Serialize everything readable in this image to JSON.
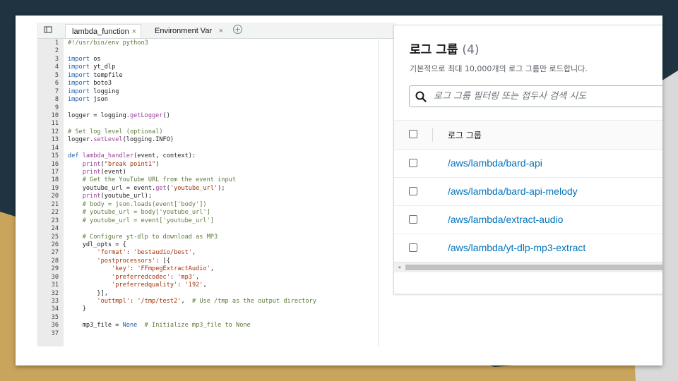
{
  "editor": {
    "tabs": [
      {
        "label": "lambda_function",
        "close": "×"
      },
      {
        "label": "Environment Var",
        "close": "×"
      }
    ],
    "add_tab": "+",
    "lines": [
      {
        "n": "1",
        "tokens": [
          {
            "t": "#!/usr/bin/env python3",
            "c": "cm"
          }
        ]
      },
      {
        "n": "2",
        "tokens": []
      },
      {
        "n": "3",
        "tokens": [
          {
            "t": "import",
            "c": "kw"
          },
          {
            "t": " os",
            "c": ""
          }
        ]
      },
      {
        "n": "4",
        "tokens": [
          {
            "t": "import",
            "c": "kw"
          },
          {
            "t": " yt_dlp",
            "c": ""
          }
        ]
      },
      {
        "n": "5",
        "tokens": [
          {
            "t": "import",
            "c": "kw"
          },
          {
            "t": " tempfile",
            "c": ""
          }
        ]
      },
      {
        "n": "6",
        "tokens": [
          {
            "t": "import",
            "c": "kw"
          },
          {
            "t": " boto3",
            "c": ""
          }
        ]
      },
      {
        "n": "7",
        "tokens": [
          {
            "t": "import",
            "c": "kw"
          },
          {
            "t": " logging",
            "c": ""
          }
        ]
      },
      {
        "n": "8",
        "tokens": [
          {
            "t": "import",
            "c": "kw"
          },
          {
            "t": " json",
            "c": ""
          }
        ]
      },
      {
        "n": "9",
        "tokens": []
      },
      {
        "n": "10",
        "tokens": [
          {
            "t": "logger = logging.",
            "c": ""
          },
          {
            "t": "getLogger",
            "c": "fn"
          },
          {
            "t": "()",
            "c": ""
          }
        ]
      },
      {
        "n": "11",
        "tokens": []
      },
      {
        "n": "12",
        "tokens": [
          {
            "t": "# Set log level (optional)",
            "c": "cm"
          }
        ]
      },
      {
        "n": "13",
        "tokens": [
          {
            "t": "logger.",
            "c": ""
          },
          {
            "t": "setLevel",
            "c": "fn"
          },
          {
            "t": "(logging.INFO)",
            "c": ""
          }
        ]
      },
      {
        "n": "14",
        "tokens": []
      },
      {
        "n": "15",
        "tokens": [
          {
            "t": "def",
            "c": "kw"
          },
          {
            "t": " ",
            "c": ""
          },
          {
            "t": "lambda_handler",
            "c": "fn"
          },
          {
            "t": "(event, context):",
            "c": ""
          }
        ]
      },
      {
        "n": "16",
        "tokens": [
          {
            "t": "    ",
            "c": ""
          },
          {
            "t": "print",
            "c": "fn"
          },
          {
            "t": "(",
            "c": ""
          },
          {
            "t": "\"break point1\"",
            "c": "str"
          },
          {
            "t": ")",
            "c": ""
          }
        ]
      },
      {
        "n": "17",
        "tokens": [
          {
            "t": "    ",
            "c": ""
          },
          {
            "t": "print",
            "c": "fn"
          },
          {
            "t": "(event)",
            "c": ""
          }
        ]
      },
      {
        "n": "18",
        "tokens": [
          {
            "t": "    # Get the YouTube URL from the event input",
            "c": "cm"
          }
        ]
      },
      {
        "n": "19",
        "tokens": [
          {
            "t": "    youtube_url = event.",
            "c": ""
          },
          {
            "t": "get",
            "c": "fn"
          },
          {
            "t": "(",
            "c": ""
          },
          {
            "t": "'youtube_url'",
            "c": "str"
          },
          {
            "t": ");",
            "c": ""
          }
        ]
      },
      {
        "n": "20",
        "tokens": [
          {
            "t": "    ",
            "c": ""
          },
          {
            "t": "print",
            "c": "fn"
          },
          {
            "t": "(youtube_url);",
            "c": ""
          }
        ]
      },
      {
        "n": "21",
        "tokens": [
          {
            "t": "    # body = json.loads(event['body'])",
            "c": "cm"
          }
        ]
      },
      {
        "n": "22",
        "tokens": [
          {
            "t": "    # youtube_url = body['youtube_url']",
            "c": "cm"
          }
        ]
      },
      {
        "n": "23",
        "tokens": [
          {
            "t": "    # youtube_url = event['youtube_url']",
            "c": "cm"
          }
        ]
      },
      {
        "n": "24",
        "tokens": []
      },
      {
        "n": "25",
        "tokens": [
          {
            "t": "    # Configure yt-dlp to download as MP3",
            "c": "cm"
          }
        ]
      },
      {
        "n": "26",
        "tokens": [
          {
            "t": "    ydl_opts = {",
            "c": ""
          }
        ]
      },
      {
        "n": "27",
        "tokens": [
          {
            "t": "        ",
            "c": ""
          },
          {
            "t": "'format'",
            "c": "str"
          },
          {
            "t": ": ",
            "c": ""
          },
          {
            "t": "'bestaudio/best'",
            "c": "str"
          },
          {
            "t": ",",
            "c": ""
          }
        ]
      },
      {
        "n": "28",
        "tokens": [
          {
            "t": "        ",
            "c": ""
          },
          {
            "t": "'postprocessors'",
            "c": "str"
          },
          {
            "t": ": [{",
            "c": ""
          }
        ]
      },
      {
        "n": "29",
        "tokens": [
          {
            "t": "            ",
            "c": ""
          },
          {
            "t": "'key'",
            "c": "str"
          },
          {
            "t": ": ",
            "c": ""
          },
          {
            "t": "'FFmpegExtractAudio'",
            "c": "str"
          },
          {
            "t": ",",
            "c": ""
          }
        ]
      },
      {
        "n": "30",
        "tokens": [
          {
            "t": "            ",
            "c": ""
          },
          {
            "t": "'preferredcodec'",
            "c": "str"
          },
          {
            "t": ": ",
            "c": ""
          },
          {
            "t": "'mp3'",
            "c": "str"
          },
          {
            "t": ",",
            "c": ""
          }
        ]
      },
      {
        "n": "31",
        "tokens": [
          {
            "t": "            ",
            "c": ""
          },
          {
            "t": "'preferredquality'",
            "c": "str"
          },
          {
            "t": ": ",
            "c": ""
          },
          {
            "t": "'192'",
            "c": "str"
          },
          {
            "t": ",",
            "c": ""
          }
        ]
      },
      {
        "n": "32",
        "tokens": [
          {
            "t": "        }],",
            "c": ""
          }
        ]
      },
      {
        "n": "33",
        "tokens": [
          {
            "t": "        ",
            "c": ""
          },
          {
            "t": "'outtmpl'",
            "c": "str"
          },
          {
            "t": ": ",
            "c": ""
          },
          {
            "t": "'/tmp/test2'",
            "c": "str"
          },
          {
            "t": ",  ",
            "c": ""
          },
          {
            "t": "# Use /tmp as the output directory",
            "c": "cm"
          }
        ]
      },
      {
        "n": "34",
        "tokens": [
          {
            "t": "    }",
            "c": ""
          }
        ]
      },
      {
        "n": "35",
        "tokens": []
      },
      {
        "n": "36",
        "tokens": [
          {
            "t": "    mp3_file = ",
            "c": ""
          },
          {
            "t": "None",
            "c": "nn"
          },
          {
            "t": "  ",
            "c": ""
          },
          {
            "t": "# Initialize mp3_file to None",
            "c": "cm"
          }
        ]
      },
      {
        "n": "37",
        "tokens": []
      }
    ]
  },
  "log_groups": {
    "title": "로그 그룹",
    "count": "(4)",
    "description": "기본적으로 최대 10,000개의 로그 그룹만 로드합니다.",
    "search_placeholder": "로그 그룹 필터링 또는 접두사 검색 시도",
    "column_header": "로그 그룹",
    "rows": [
      "/aws/lambda/bard-api",
      "/aws/lambda/bard-api-melody",
      "/aws/lambda/extract-audio",
      "/aws/lambda/yt-dlp-mp3-extract"
    ]
  },
  "colors": {
    "background_dark": "#1f3440",
    "background_gold": "#c9a45c",
    "link": "#0073bb"
  }
}
